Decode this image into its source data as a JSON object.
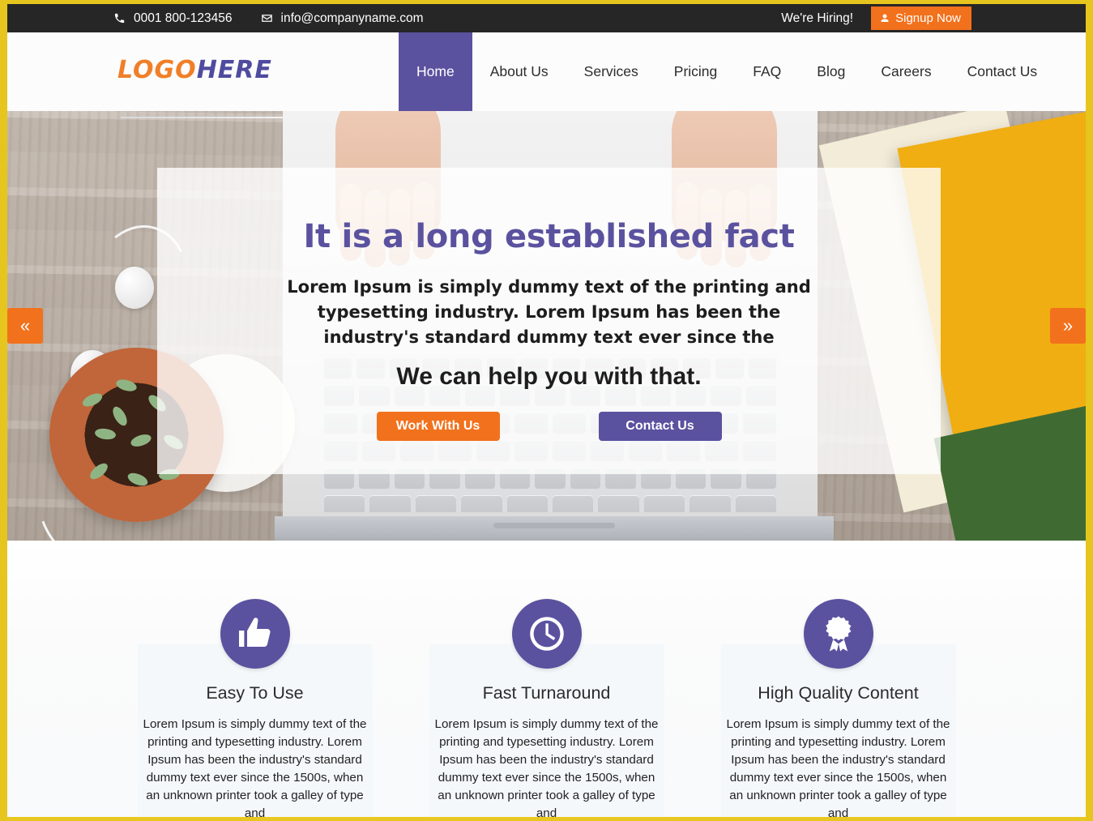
{
  "topbar": {
    "phone": "0001 800-123456",
    "phone_icon": "phone-icon",
    "email": "info@companyname.com",
    "email_icon": "envelope-icon",
    "hiring_text": "We're Hiring!",
    "signup_label": "Signup Now",
    "signup_icon": "user-icon",
    "bg_color": "#262626",
    "accent_color": "#f2711c"
  },
  "header": {
    "logo_part1": "LOGO",
    "logo_part2": "HERE",
    "logo_color1": "#f07f28",
    "logo_color2": "#4f4b9e",
    "nav": [
      {
        "label": "Home",
        "active": true
      },
      {
        "label": "About Us",
        "active": false
      },
      {
        "label": "Services",
        "active": false
      },
      {
        "label": "Pricing",
        "active": false
      },
      {
        "label": "FAQ",
        "active": false
      },
      {
        "label": "Blog",
        "active": false
      },
      {
        "label": "Careers",
        "active": false
      },
      {
        "label": "Contact Us",
        "active": false
      }
    ],
    "active_bg": "#5a529f"
  },
  "hero": {
    "heading": "It is a long established fact",
    "heading_color": "#5a529f",
    "paragraph": "Lorem Ipsum is simply dummy text of the printing and typesetting industry. Lorem Ipsum has been the industry's standard dummy text ever since the",
    "subheading": "We can help you with that.",
    "primary_button": "Work With Us",
    "secondary_button": "Contact Us",
    "primary_button_color": "#f2711c",
    "secondary_button_color": "#5a529f",
    "prev_arrow": "«",
    "next_arrow": "»"
  },
  "features": {
    "icon_color": "#5a529f",
    "cards": [
      {
        "icon": "thumbs-up-icon",
        "title": "Easy To Use",
        "text": "Lorem Ipsum is simply dummy text of the printing and typesetting industry. Lorem Ipsum has been the industry's standard dummy text ever since the 1500s, when an unknown printer took a galley of type and"
      },
      {
        "icon": "clock-icon",
        "title": "Fast Turnaround",
        "text": "Lorem Ipsum is simply dummy text of the printing and typesetting industry. Lorem Ipsum has been the industry's standard dummy text ever since the 1500s, when an unknown printer took a galley of type and"
      },
      {
        "icon": "award-ribbon-icon",
        "title": "High Quality Content",
        "text": "Lorem Ipsum is simply dummy text of the printing and typesetting industry. Lorem Ipsum has been the industry's standard dummy text ever since the 1500s, when an unknown printer took a galley of type and"
      }
    ]
  },
  "page": {
    "border_color": "#e6c51e"
  }
}
